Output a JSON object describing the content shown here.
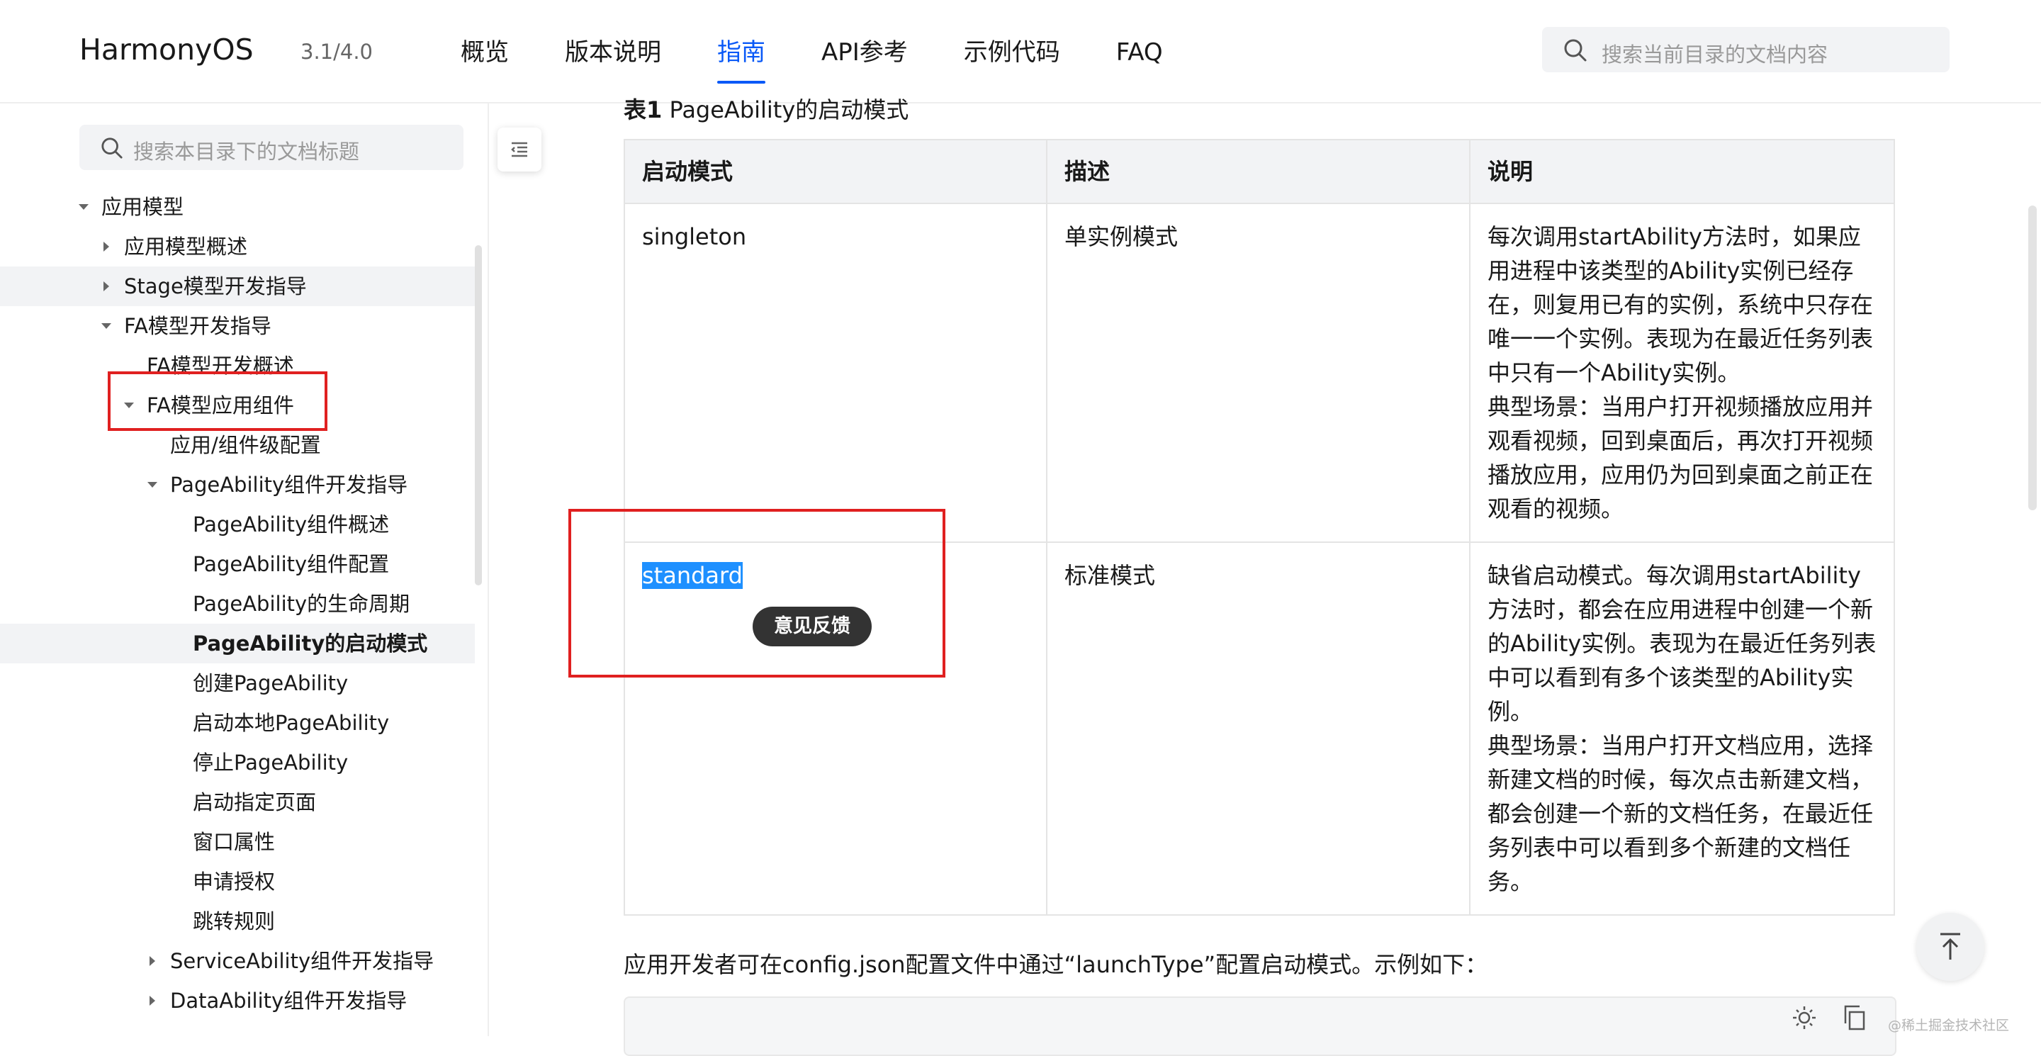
{
  "header": {
    "logo": "HarmonyOS",
    "version": "3.1/4.0",
    "nav": [
      "概览",
      "版本说明",
      "指南",
      "API参考",
      "示例代码",
      "FAQ"
    ],
    "active_nav": "指南",
    "search_placeholder": "搜索当前目录的文档内容"
  },
  "sidebar": {
    "search_placeholder": "搜索本目录下的文档标题",
    "items": [
      {
        "label": "应用模型",
        "caret": "down"
      },
      {
        "label": "应用模型概述",
        "caret": "right"
      },
      {
        "label": "Stage模型开发指导",
        "caret": "right",
        "highlighted": true
      },
      {
        "label": "FA模型开发指导",
        "caret": "down"
      },
      {
        "label": "FA模型开发概述",
        "caret": "none"
      },
      {
        "label": "FA模型应用组件",
        "caret": "down"
      },
      {
        "label": "应用/组件级配置",
        "caret": "none"
      },
      {
        "label": "PageAbility组件开发指导",
        "caret": "down"
      },
      {
        "label": "PageAbility组件概述",
        "caret": "none"
      },
      {
        "label": "PageAbility组件配置",
        "caret": "none"
      },
      {
        "label": "PageAbility的生命周期",
        "caret": "none"
      },
      {
        "label": "PageAbility的启动模式",
        "caret": "none",
        "current": true
      },
      {
        "label": "创建PageAbility",
        "caret": "none"
      },
      {
        "label": "启动本地PageAbility",
        "caret": "none"
      },
      {
        "label": "停止PageAbility",
        "caret": "none"
      },
      {
        "label": "启动指定页面",
        "caret": "none"
      },
      {
        "label": "窗口属性",
        "caret": "none"
      },
      {
        "label": "申请授权",
        "caret": "none"
      },
      {
        "label": "跳转规则",
        "caret": "none"
      },
      {
        "label": "ServiceAbility组件开发指导",
        "caret": "right"
      },
      {
        "label": "DataAbility组件开发指导",
        "caret": "right"
      }
    ]
  },
  "main": {
    "table_caption_bold": "表1",
    "table_caption": "PageAbility的启动模式",
    "table": {
      "headers": [
        "启动模式",
        "描述",
        "说明"
      ],
      "rows": [
        {
          "mode": "singleton",
          "desc": "单实例模式",
          "note": "每次调用startAbility方法时，如果应用进程中该类型的Ability实例已经存在，则复用已有的实例，系统中只存在唯一一个实例。表现为在最近任务列表中只有一个Ability实例。",
          "scene": "典型场景：当用户打开视频播放应用并观看视频，回到桌面后，再次打开视频播放应用，应用仍为回到桌面之前正在观看的视频。"
        },
        {
          "mode": "standard",
          "desc": "标准模式",
          "note": "缺省启动模式。每次调用startAbility方法时，都会在应用进程中创建一个新的Ability实例。表现为在最近任务列表中可以看到有多个该类型的Ability实例。",
          "scene": "典型场景：当用户打开文档应用，选择新建文档的时候，每次点击新建文档，都会创建一个新的文档任务，在最近任务列表中可以看到多个新建的文档任务。"
        }
      ]
    },
    "feedback_label": "意见反馈",
    "paragraph": "应用开发者可在config.json配置文件中通过“launchType”配置启动模式。示例如下：",
    "watermark": "@稀土掘金技术社区"
  },
  "colors": {
    "accent": "#0a59f7",
    "annotation": "#e02020",
    "selection": "#1e90ff"
  }
}
